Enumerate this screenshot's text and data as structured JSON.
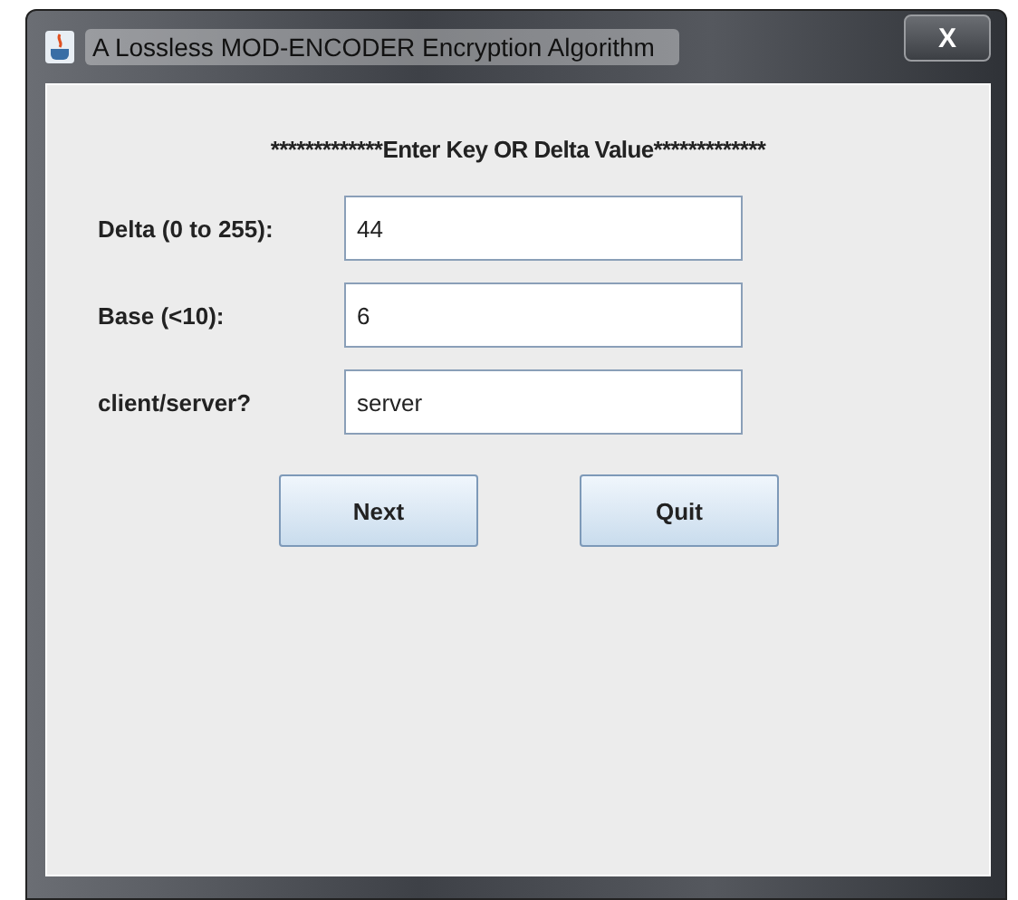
{
  "window": {
    "title": "A Lossless MOD-ENCODER Encryption Algorithm",
    "close": "X"
  },
  "heading": "*************Enter Key OR Delta Value*************",
  "fields": [
    {
      "label": "Delta (0 to 255):",
      "value": "44"
    },
    {
      "label": "Base (<10):",
      "value": "6"
    },
    {
      "label": "client/server?",
      "value": "server"
    }
  ],
  "buttons": [
    "Next",
    "Quit"
  ]
}
